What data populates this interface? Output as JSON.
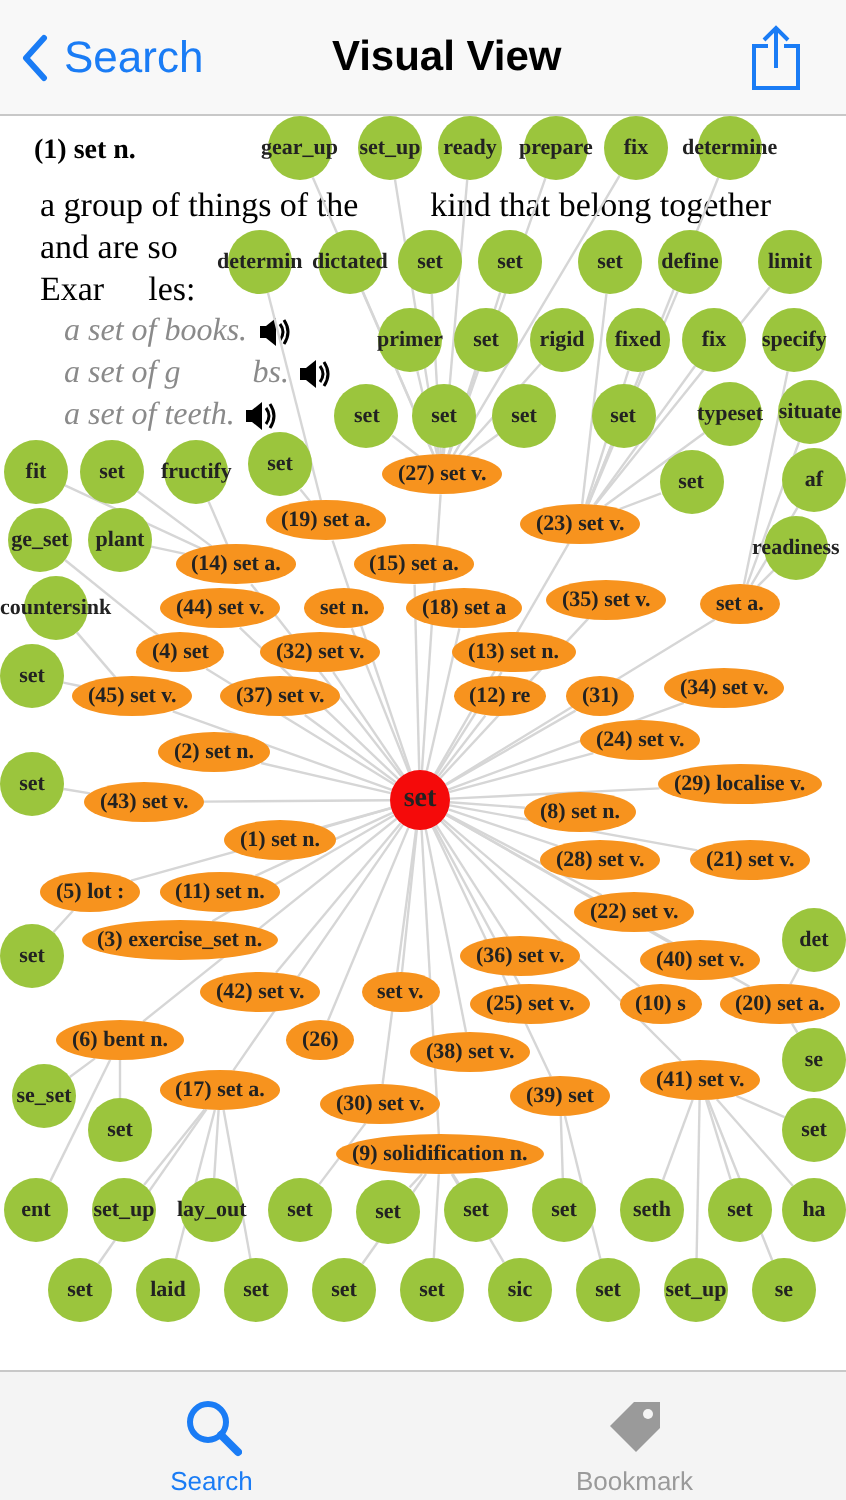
{
  "nav": {
    "back_label": "Search",
    "title": "Visual View"
  },
  "definition": {
    "heading": "(1) set n.",
    "lines": [
      [
        "a group of things of the",
        "kind that belong together"
      ],
      [
        "and are so"
      ],
      [
        "Exar",
        "les:"
      ]
    ],
    "examples": [
      [
        "a set of books."
      ],
      [
        "a set of g",
        "bs."
      ],
      [
        "a set of teeth."
      ]
    ]
  },
  "graph": {
    "center": "set",
    "senses": [
      {
        "label": "(27) set v."
      },
      {
        "label": "(19) set a."
      },
      {
        "label": "(23) set v."
      },
      {
        "label": "(14) set a."
      },
      {
        "label": "(15) set a."
      },
      {
        "label": "(44) set v."
      },
      {
        "label": "set n."
      },
      {
        "label": "(18) set a"
      },
      {
        "label": "(35) set v."
      },
      {
        "label": "set a."
      },
      {
        "label": "(4) set"
      },
      {
        "label": "(32) set v."
      },
      {
        "label": "(13) set n."
      },
      {
        "label": "(45) set v."
      },
      {
        "label": "(37) set v."
      },
      {
        "label": "(12) re"
      },
      {
        "label": "(31)"
      },
      {
        "label": "(34) set v."
      },
      {
        "label": "(24) set v."
      },
      {
        "label": "(2) set n."
      },
      {
        "label": "(29) localise v."
      },
      {
        "label": "(43) set v."
      },
      {
        "label": "(8) set n."
      },
      {
        "label": "(1) set n."
      },
      {
        "label": "(28) set v."
      },
      {
        "label": "(21) set v."
      },
      {
        "label": "(5) lot :"
      },
      {
        "label": "(11) set n."
      },
      {
        "label": "(22) set v."
      },
      {
        "label": "(3) exercise_set n."
      },
      {
        "label": "(36) set v."
      },
      {
        "label": "(40) set v."
      },
      {
        "label": "(42) set v."
      },
      {
        "label": "set v."
      },
      {
        "label": "(25) set v."
      },
      {
        "label": "(10) s"
      },
      {
        "label": "(20) set a."
      },
      {
        "label": "(6) bent n."
      },
      {
        "label": "(26)"
      },
      {
        "label": "(38) set v."
      },
      {
        "label": "(41) set v."
      },
      {
        "label": "(17) set a."
      },
      {
        "label": "(39) set"
      },
      {
        "label": "(30) set v."
      },
      {
        "label": "(9) solidification n."
      }
    ],
    "words": [
      {
        "label": "gear_up"
      },
      {
        "label": "set_up"
      },
      {
        "label": "ready"
      },
      {
        "label": "prepare"
      },
      {
        "label": "fix"
      },
      {
        "label": "determine"
      },
      {
        "label": "determin"
      },
      {
        "label": "dictated"
      },
      {
        "label": "set"
      },
      {
        "label": "set"
      },
      {
        "label": "set"
      },
      {
        "label": "define"
      },
      {
        "label": "limit"
      },
      {
        "label": "primer"
      },
      {
        "label": "set"
      },
      {
        "label": "rigid"
      },
      {
        "label": "fixed"
      },
      {
        "label": "fix"
      },
      {
        "label": "specify"
      },
      {
        "label": "set"
      },
      {
        "label": "set"
      },
      {
        "label": "set"
      },
      {
        "label": "set"
      },
      {
        "label": "typeset"
      },
      {
        "label": "situate"
      },
      {
        "label": "fit"
      },
      {
        "label": "set"
      },
      {
        "label": "fructify"
      },
      {
        "label": "set"
      },
      {
        "label": "set"
      },
      {
        "label": "af"
      },
      {
        "label": "ge_set"
      },
      {
        "label": "plant"
      },
      {
        "label": "readiness"
      },
      {
        "label": "countersink"
      },
      {
        "label": "set"
      },
      {
        "label": "set"
      },
      {
        "label": "det"
      },
      {
        "label": "set"
      },
      {
        "label": "se"
      },
      {
        "label": "se_set"
      },
      {
        "label": "set"
      },
      {
        "label": "set"
      },
      {
        "label": "ent"
      },
      {
        "label": "set_up"
      },
      {
        "label": "lay_out"
      },
      {
        "label": "set"
      },
      {
        "label": "set"
      },
      {
        "label": "set"
      },
      {
        "label": "set"
      },
      {
        "label": "seth"
      },
      {
        "label": "set"
      },
      {
        "label": "ha"
      },
      {
        "label": "set"
      },
      {
        "label": "laid"
      },
      {
        "label": "set"
      },
      {
        "label": "set"
      },
      {
        "label": "set"
      },
      {
        "label": "sic"
      },
      {
        "label": "set"
      },
      {
        "label": "set_up"
      },
      {
        "label": "se"
      }
    ]
  },
  "tabs": [
    {
      "label": "Search",
      "kind": "search",
      "selected": true
    },
    {
      "label": "Bookmark",
      "kind": "bookmark",
      "selected": false
    }
  ]
}
